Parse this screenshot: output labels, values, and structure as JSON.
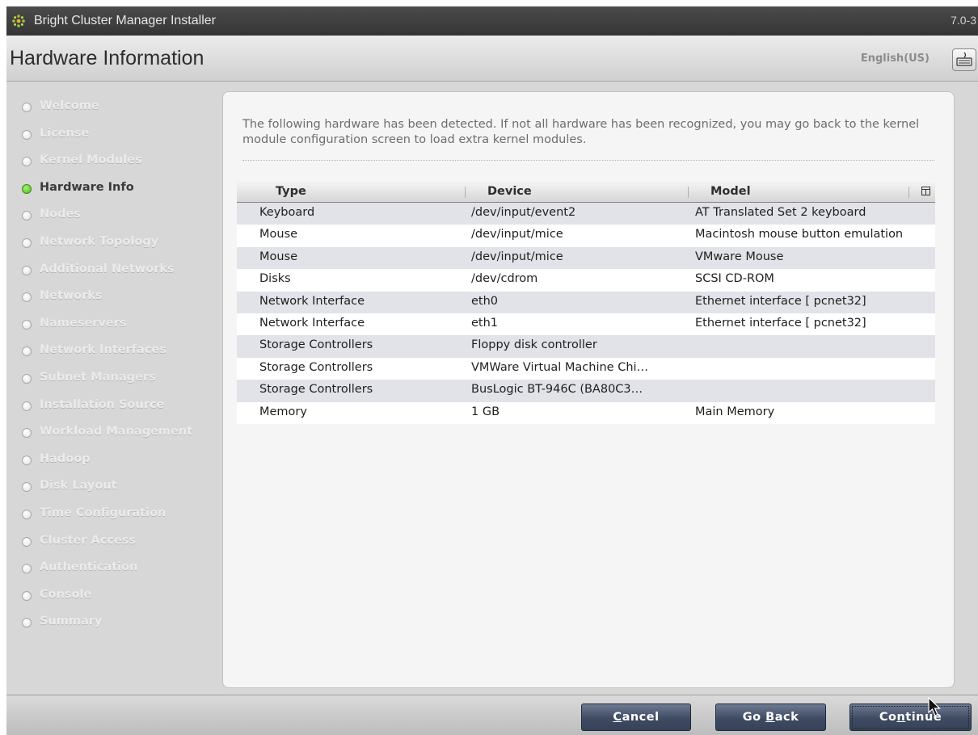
{
  "window": {
    "title": "Bright Cluster Manager Installer",
    "version": "7.0-3"
  },
  "header": {
    "page_title": "Hardware Information",
    "language": "English(US)",
    "keyboard_icon": "keyboard-icon"
  },
  "sidebar": {
    "active_index": 3,
    "items": [
      {
        "label": "Welcome"
      },
      {
        "label": "License"
      },
      {
        "label": "Kernel Modules"
      },
      {
        "label": "Hardware Info"
      },
      {
        "label": "Nodes"
      },
      {
        "label": "Network Topology"
      },
      {
        "label": "Additional Networks"
      },
      {
        "label": "Networks"
      },
      {
        "label": "Nameservers"
      },
      {
        "label": "Network Interfaces"
      },
      {
        "label": "Subnet Managers"
      },
      {
        "label": "Installation Source"
      },
      {
        "label": "Workload Management"
      },
      {
        "label": "Hadoop"
      },
      {
        "label": "Disk Layout"
      },
      {
        "label": "Time Configuration"
      },
      {
        "label": "Cluster Access"
      },
      {
        "label": "Authentication"
      },
      {
        "label": "Console"
      },
      {
        "label": "Summary"
      }
    ]
  },
  "main": {
    "intro": "The following hardware has been detected. If not all hardware has been recognized, you may go back to the kernel module configuration screen to load extra kernel modules.",
    "table": {
      "headers": {
        "type": "Type",
        "device": "Device",
        "model": "Model"
      },
      "rows": [
        {
          "type": "Keyboard",
          "device": "/dev/input/event2",
          "model": "AT Translated Set 2 keyboard"
        },
        {
          "type": "Mouse",
          "device": "/dev/input/mice",
          "model": "Macintosh mouse button emulation"
        },
        {
          "type": "Mouse",
          "device": "/dev/input/mice",
          "model": "VMware Mouse"
        },
        {
          "type": "Disks",
          "device": "/dev/cdrom",
          "model": "SCSI CD-ROM"
        },
        {
          "type": "Network Interface",
          "device": "eth0",
          "model": "Ethernet interface [ pcnet32]"
        },
        {
          "type": "Network Interface",
          "device": "eth1",
          "model": "Ethernet interface [ pcnet32]"
        },
        {
          "type": "Storage Controllers",
          "device": "Floppy disk controller",
          "model": ""
        },
        {
          "type": "Storage Controllers",
          "device": "VMWare Virtual Machine Chi…",
          "model": ""
        },
        {
          "type": "Storage Controllers",
          "device": "BusLogic BT-946C (BA80C3…",
          "model": ""
        },
        {
          "type": "Memory",
          "device": "1 GB",
          "model": "Main Memory"
        }
      ]
    }
  },
  "footer": {
    "cancel": {
      "pre": "",
      "mnemonic": "C",
      "post": "ancel"
    },
    "go_back": {
      "pre": "Go ",
      "mnemonic": "B",
      "post": "ack"
    },
    "continue": {
      "pre": "Co",
      "mnemonic": "n",
      "post": "tinue"
    }
  }
}
